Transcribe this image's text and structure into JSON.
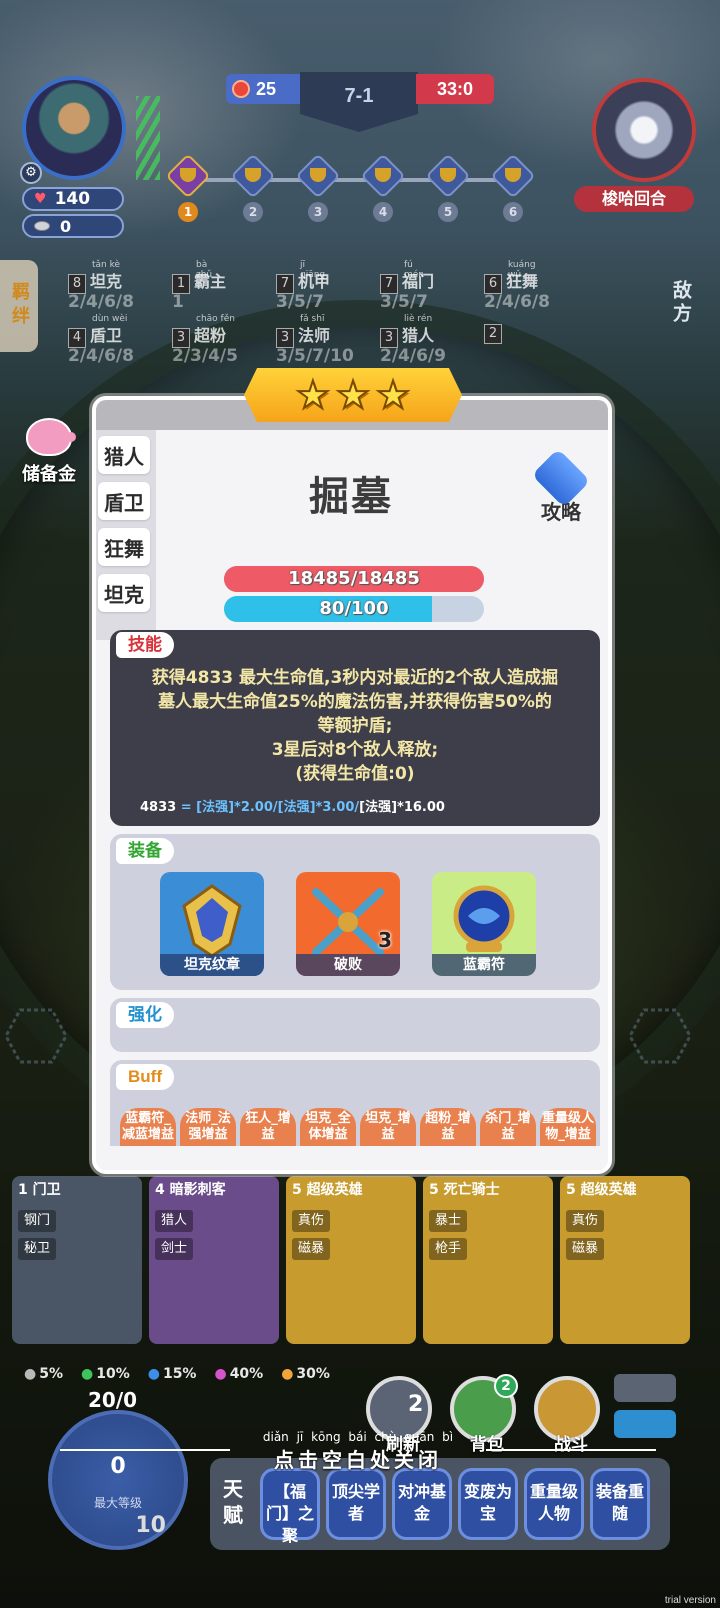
{
  "hud": {
    "round": "7-1",
    "player_score": "25",
    "enemy_score": "33:0",
    "player_hp": "140",
    "player_coins": "0",
    "enemy_round_label": "梭哈回合",
    "trophies": [
      "1",
      "2",
      "3",
      "4",
      "5",
      "6"
    ],
    "side_tab_left": "羁绊",
    "side_enemy": "敌方",
    "savings_label": "储备金"
  },
  "synergies": [
    {
      "count": "8",
      "pinyin": "tǎn kè",
      "name": "坦克",
      "progress": "2/4/6/8"
    },
    {
      "count": "1",
      "pinyin": "bà zhǔ",
      "name": "霸主",
      "progress": "1"
    },
    {
      "count": "7",
      "pinyin": "jī qiāng",
      "name": "机甲",
      "progress": "3/5/7"
    },
    {
      "count": "7",
      "pinyin": "fú mén",
      "name": "福门",
      "progress": "3/5/7"
    },
    {
      "count": "6",
      "pinyin": "kuáng wǔ",
      "name": "狂舞",
      "progress": "2/4/6/8"
    },
    {
      "count": "4",
      "pinyin": "dùn wèi",
      "name": "盾卫",
      "progress": "2/4/6/8"
    },
    {
      "count": "3",
      "pinyin": "chāo fěn",
      "name": "超粉",
      "progress": "2/3/4/5"
    },
    {
      "count": "3",
      "pinyin": "fǎ shī",
      "name": "法师",
      "progress": "3/5/7/10"
    },
    {
      "count": "3",
      "pinyin": "liè rén",
      "name": "猎人",
      "progress": "2/4/6/9"
    },
    {
      "count": "2",
      "pinyin": "",
      "name": "",
      "progress": ""
    }
  ],
  "modal": {
    "hero_name": "掘墓",
    "guide_label": "攻略",
    "trait_tabs": [
      "猎人",
      "盾卫",
      "狂舞",
      "坦克"
    ],
    "hp_text": "18485/18485",
    "hp_ratio": 1.0,
    "mana_text": "80/100",
    "mana_ratio": 0.8,
    "skill_tag": "技能",
    "skill_lines": [
      "获得4833 最大生命值,3秒内对最近的2个敌人造成掘",
      "墓人最大生命值25%的魔法伤害,并获得伤害50%的",
      "等额护盾;",
      "3星后对8个敌人释放;",
      "(获得生命值:0)"
    ],
    "formula_value": "4833",
    "formula_eq": " = ",
    "formula_part1": "[法强]*2.00/[法强]*3.00/",
    "formula_part2": "[法强]*16.00",
    "equip_tag": "装备",
    "equipment": [
      {
        "name": "坦克纹章",
        "stack": ""
      },
      {
        "name": "破败",
        "stack": "3"
      },
      {
        "name": "蓝霸符",
        "stack": ""
      }
    ],
    "enhance_tag": "强化",
    "buff_tag": "Buff",
    "buffs": [
      "蓝霸符_减蓝增益",
      "法师_法强增益",
      "狂人_增益",
      "坦克_全体增益",
      "坦克_增益",
      "超粉_增益",
      "杀门_增益",
      "重量级人物_增益"
    ],
    "star_count": 3
  },
  "shop": {
    "cards": [
      {
        "cost": "1",
        "name": "门卫",
        "traits": [
          "钢门",
          "秘卫"
        ],
        "color": "#4a5666"
      },
      {
        "cost": "4",
        "name": "暗影刺客",
        "traits": [
          "猎人",
          "剑士"
        ],
        "color": "#6b4c8a"
      },
      {
        "cost": "5",
        "name": "超级英雄",
        "traits": [
          "真伤",
          "磁暴"
        ],
        "color": "#c79b2e"
      },
      {
        "cost": "5",
        "name": "死亡骑士",
        "traits": [
          "暴士",
          "枪手"
        ],
        "color": "#c79b2e"
      },
      {
        "cost": "5",
        "name": "超级英雄",
        "traits": [
          "真伤",
          "磁暴"
        ],
        "color": "#c79b2e"
      }
    ],
    "odds": [
      "5%",
      "10%",
      "15%",
      "40%",
      "30%"
    ]
  },
  "bottom": {
    "xp": "20/0",
    "level_coins": "0",
    "level_caption": "最大等级",
    "level": "10",
    "refresh_cost": "2",
    "refresh_label": "刷新",
    "bag_label": "背包",
    "bag_badge": "2",
    "fight_label": "战斗",
    "close_hint": "点击空白处关闭",
    "close_hint_pinyin": "diǎn jī kōng bái chù guān bì",
    "talent_label": "天赋",
    "talents": [
      "【福门】之聚",
      "顶尖学者",
      "对冲基金",
      "变废为宝",
      "重量级人物",
      "装备重随"
    ],
    "trial": "trial version"
  }
}
